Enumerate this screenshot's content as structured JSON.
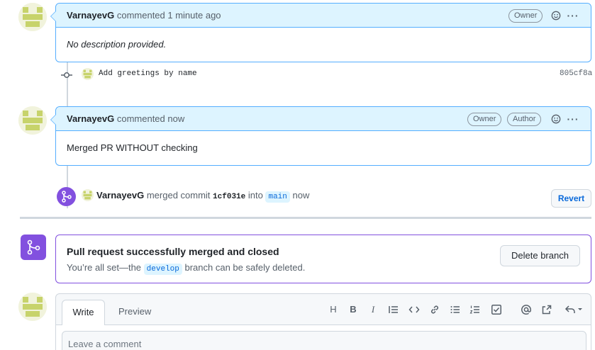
{
  "comment1": {
    "author": "VarnayevG",
    "action_text": "commented 1 minute ago",
    "badge_owner": "Owner",
    "body": "No description provided."
  },
  "commit": {
    "message": "Add greetings by name",
    "sha": "805cf8a"
  },
  "comment2": {
    "author": "VarnayevG",
    "action_text": "commented now",
    "badge_owner": "Owner",
    "badge_author": "Author",
    "body": "Merged PR WITHOUT checking"
  },
  "merge_event": {
    "author": "VarnayevG",
    "text_merged": "merged commit",
    "commit_sha": "1cf031e",
    "text_into": "into",
    "branch": "main",
    "time": "now",
    "revert_label": "Revert"
  },
  "merged_box": {
    "title": "Pull request successfully merged and closed",
    "subtitle_prefix": "You’re all set—the",
    "branch": "develop",
    "subtitle_suffix": "branch can be safely deleted.",
    "delete_label": "Delete branch"
  },
  "editor": {
    "tab_write": "Write",
    "tab_preview": "Preview",
    "placeholder": "Leave a comment",
    "toolbar_heading": "H",
    "toolbar_bold": "B",
    "toolbar_italic": "I"
  },
  "colors": {
    "accent": "#0969da",
    "merged_purple": "#8250df",
    "comment_header_bg": "#ddf4ff",
    "comment_border": "#54aeff"
  },
  "icons": [
    "smiley-icon",
    "kebab-icon",
    "commit-icon",
    "merge-icon",
    "quote-icon",
    "code-icon",
    "link-icon",
    "unordered-list-icon",
    "ordered-list-icon",
    "tasklist-icon",
    "mention-icon",
    "cross-reference-icon",
    "reply-icon"
  ]
}
